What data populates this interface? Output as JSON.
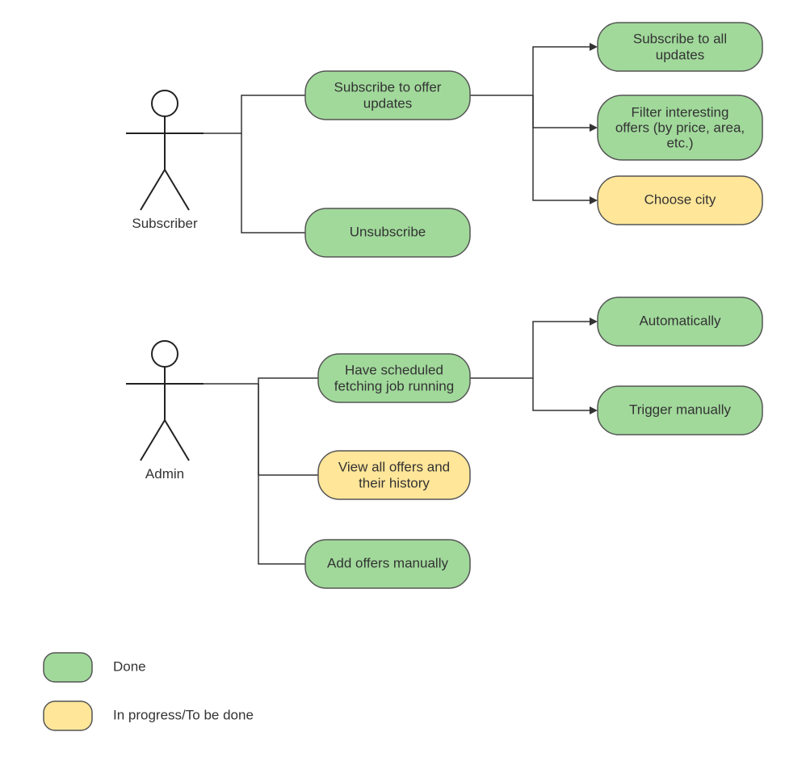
{
  "actors": {
    "subscriber": {
      "label": "Subscriber"
    },
    "admin": {
      "label": "Admin"
    }
  },
  "usecases": {
    "subscribe_updates": {
      "label_l1": "Subscribe to offer",
      "label_l2": "updates",
      "status": "done"
    },
    "unsubscribe": {
      "label_l1": "Unsubscribe",
      "status": "done"
    },
    "subscribe_all": {
      "label_l1": "Subscribe to all",
      "label_l2": "updates",
      "status": "done"
    },
    "filter_offers": {
      "label_l1": "Filter interesting",
      "label_l2": "offers (by price, area,",
      "label_l3": "etc.)",
      "status": "done"
    },
    "choose_city": {
      "label_l1": "Choose city",
      "status": "todo"
    },
    "scheduled_job": {
      "label_l1": "Have scheduled",
      "label_l2": "fetching job running",
      "status": "done"
    },
    "automatically": {
      "label_l1": "Automatically",
      "status": "done"
    },
    "trigger_manually": {
      "label_l1": "Trigger manually",
      "status": "done"
    },
    "view_history": {
      "label_l1": "View all offers and",
      "label_l2": "their history",
      "status": "todo"
    },
    "add_manually": {
      "label_l1": "Add offers manually",
      "status": "done"
    }
  },
  "legend": {
    "done": "Done",
    "todo": "In progress/To be done"
  },
  "colors": {
    "done": "#a1d99b",
    "todo": "#ffe699",
    "stroke": "#555555"
  }
}
